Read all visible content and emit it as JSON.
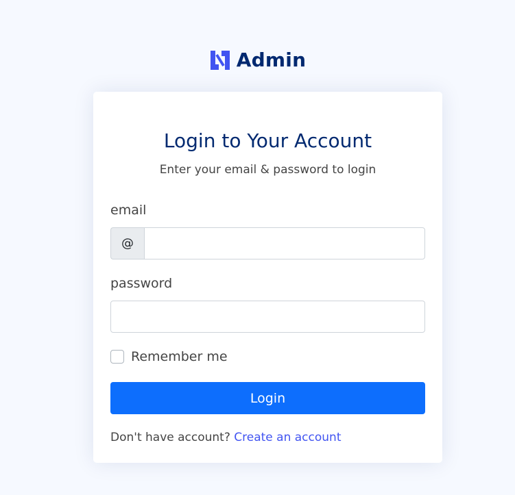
{
  "brand": {
    "name": "Admin",
    "logo_icon": "logo-icon",
    "logo_color": "#4154f1",
    "text_color": "#012970"
  },
  "card": {
    "title": "Login to Your Account",
    "subtitle": "Enter your email & password to login"
  },
  "form": {
    "email": {
      "label": "email",
      "prefix": "@",
      "value": "",
      "placeholder": ""
    },
    "password": {
      "label": "password",
      "value": "",
      "placeholder": ""
    },
    "remember": {
      "label": "Remember me",
      "checked": false
    },
    "submit_label": "Login",
    "submit_color": "#0d6efd"
  },
  "footer": {
    "prompt": "Don't have account?",
    "link_label": "Create an account",
    "link_color": "#4154f1"
  },
  "colors": {
    "page_background": "#f6f9ff",
    "card_background": "#ffffff"
  }
}
